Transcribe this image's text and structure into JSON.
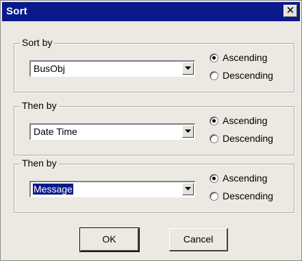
{
  "window": {
    "title": "Sort",
    "close_glyph": "✕"
  },
  "groups": [
    {
      "label": "Sort by",
      "value": "BusObj",
      "selected_text": false,
      "ascending_label": "Ascending",
      "descending_label": "Descending",
      "order": "ascending"
    },
    {
      "label": "Then by",
      "value": "Date Time",
      "selected_text": false,
      "ascending_label": "Ascending",
      "descending_label": "Descending",
      "order": "ascending"
    },
    {
      "label": "Then by",
      "value": "Message",
      "selected_text": true,
      "ascending_label": "Ascending",
      "descending_label": "Descending",
      "order": "ascending"
    }
  ],
  "buttons": {
    "ok_label": "OK",
    "cancel_label": "Cancel"
  },
  "colors": {
    "titlebar": "#0a1a8c",
    "dialog_bg": "#ece9e2",
    "selection": "#0a1a8c"
  }
}
